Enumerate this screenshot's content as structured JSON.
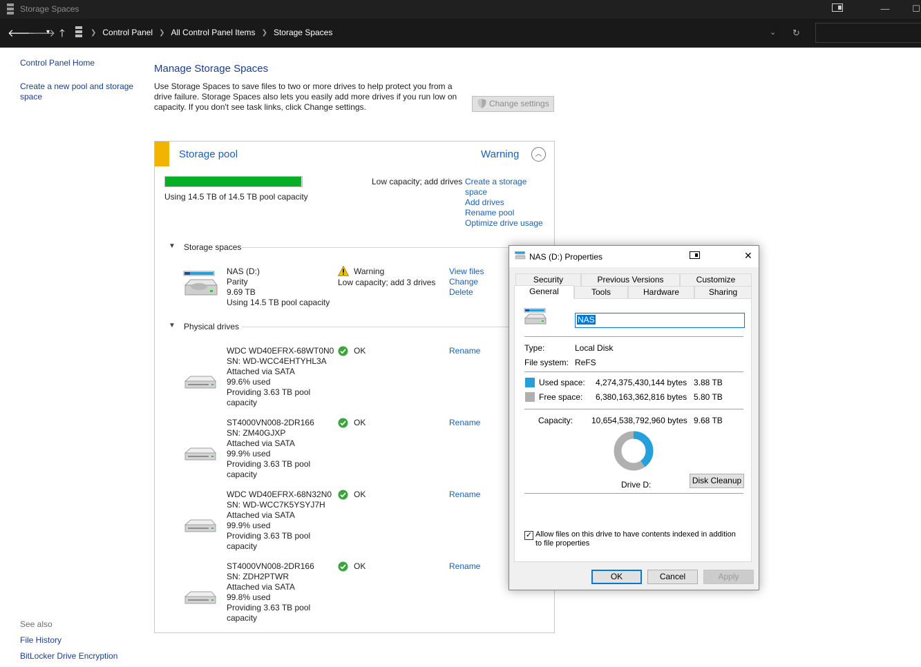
{
  "window": {
    "title": "Storage Spaces"
  },
  "breadcrumb": [
    "Control Panel",
    "All Control Panel Items",
    "Storage Spaces"
  ],
  "left_nav": {
    "items": [
      "Control Panel Home",
      "Create a new pool and storage space"
    ],
    "see_also_label": "See also",
    "see_also": [
      "File History",
      "BitLocker Drive Encryption"
    ]
  },
  "main": {
    "heading": "Manage Storage Spaces",
    "description": "Use Storage Spaces to save files to two or more drives to help protect you from a drive failure. Storage Spaces also lets you easily add more drives if you run low on capacity. If you don't see task links, click Change settings.",
    "change_settings_label": "Change settings"
  },
  "pool": {
    "title": "Storage pool",
    "status": "Warning",
    "usage_fraction": 0.995,
    "usage_text": "Using 14.5 TB of 14.5 TB pool capacity",
    "alert_text": "Low capacity; add drives",
    "actions": [
      "Create a storage space",
      "Add drives",
      "Rename pool",
      "Optimize drive usage"
    ],
    "storage_spaces_label": "Storage spaces",
    "physical_drives_label": "Physical drives",
    "space": {
      "name": "NAS (D:)",
      "resiliency": "Parity",
      "size": "9.69 TB",
      "usage": "Using 14.5 TB pool capacity",
      "status": "Warning",
      "status_detail": "Low capacity; add 3 drives",
      "actions": [
        "View files",
        "Change",
        "Delete"
      ]
    },
    "drives": [
      {
        "model": "WDC WD40EFRX-68WT0N0",
        "serial": "SN: WD-WCC4EHTYHL3A",
        "connection": "Attached via SATA",
        "used": "99.6% used",
        "providing": "Providing 3.63 TB pool capacity",
        "status": "OK",
        "action": "Rename"
      },
      {
        "model": "ST4000VN008-2DR166",
        "serial": "SN: ZM40GJXP",
        "connection": "Attached via SATA",
        "used": "99.9% used",
        "providing": "Providing 3.63 TB pool capacity",
        "status": "OK",
        "action": "Rename"
      },
      {
        "model": "WDC WD40EFRX-68N32N0",
        "serial": "SN: WD-WCC7K5YSYJ7H",
        "connection": "Attached via SATA",
        "used": "99.9% used",
        "providing": "Providing 3.63 TB pool capacity",
        "status": "OK",
        "action": "Rename"
      },
      {
        "model": "ST4000VN008-2DR166",
        "serial": "SN: ZDH2PTWR",
        "connection": "Attached via SATA",
        "used": "99.8% used",
        "providing": "Providing 3.63 TB pool capacity",
        "status": "OK",
        "action": "Rename"
      }
    ]
  },
  "dialog": {
    "title": "NAS (D:) Properties",
    "tabs_row1": [
      "Security",
      "Previous Versions",
      "Customize"
    ],
    "tabs_row2": [
      "General",
      "Tools",
      "Hardware",
      "Sharing"
    ],
    "active_tab": "General",
    "name_value": "NAS",
    "type_label": "Type:",
    "type_value": "Local Disk",
    "fs_label": "File system:",
    "fs_value": "ReFS",
    "used_label": "Used space:",
    "used_bytes": "4,274,375,430,144 bytes",
    "used_size": "3.88 TB",
    "free_label": "Free space:",
    "free_bytes": "6,380,163,362,816 bytes",
    "free_size": "5.80 TB",
    "capacity_label": "Capacity:",
    "capacity_bytes": "10,654,538,792,960 bytes",
    "capacity_size": "9.68 TB",
    "used_fraction": 0.401,
    "drive_label": "Drive D:",
    "disk_cleanup_label": "Disk Cleanup",
    "index_checkbox_label": "Allow files on this drive to have contents indexed in addition to file properties",
    "index_checked": true,
    "ok_label": "OK",
    "cancel_label": "Cancel",
    "apply_label": "Apply",
    "colors": {
      "used": "#26a0da",
      "free": "#b0b0b0"
    }
  }
}
